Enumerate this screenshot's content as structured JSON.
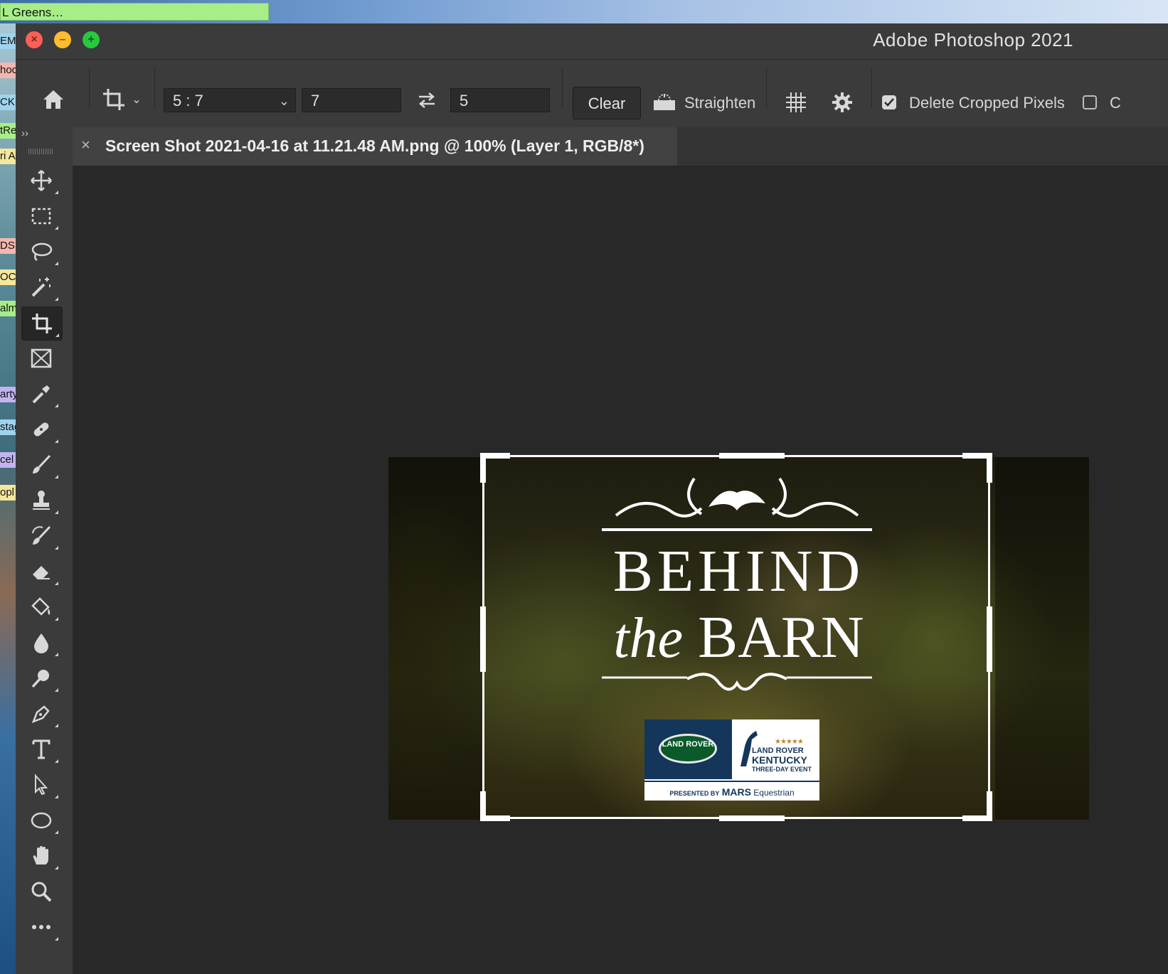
{
  "desktop": {
    "top_tab": "L Greens…",
    "side_labels": [
      "EM",
      "hoc",
      "CK",
      "tRe",
      "ri A",
      "DS",
      "OCI",
      "alm",
      "arty",
      "stag",
      "cel",
      "opl"
    ]
  },
  "window": {
    "title": "Adobe Photoshop 2021",
    "traffic_lights": [
      "close",
      "minimize",
      "maximize"
    ]
  },
  "options_bar": {
    "home_icon": "home-icon",
    "crop_preset_icon": "crop-icon",
    "ratio_preset": "5 : 7",
    "width_value": "7",
    "swap_icon": "swap-arrows-icon",
    "height_value": "5",
    "clear_label": "Clear",
    "straighten_label": "Straighten",
    "overlay_icon": "grid-icon",
    "settings_icon": "gear-icon",
    "delete_cropped_pixels_label": "Delete Cropped Pixels",
    "delete_cropped_pixels_checked": true,
    "content_aware_partial": "C"
  },
  "collapse_label": "››",
  "document": {
    "tab_title": "Screen Shot 2021-04-16 at 11.21.48 AM.png @ 100% (Layer 1, RGB/8*)",
    "tab_close": "×"
  },
  "toolbar": {
    "tools": [
      {
        "name": "move",
        "icon": "move-icon"
      },
      {
        "name": "rectangular-marquee",
        "icon": "marquee-icon"
      },
      {
        "name": "lasso",
        "icon": "lasso-icon"
      },
      {
        "name": "magic-wand",
        "icon": "magic-wand-icon"
      },
      {
        "name": "crop",
        "icon": "crop-icon",
        "active": true
      },
      {
        "name": "frame",
        "icon": "frame-icon"
      },
      {
        "name": "eyedropper",
        "icon": "eyedropper-icon"
      },
      {
        "name": "healing-brush",
        "icon": "bandage-icon"
      },
      {
        "name": "brush",
        "icon": "brush-icon"
      },
      {
        "name": "clone-stamp",
        "icon": "stamp-icon"
      },
      {
        "name": "history-brush",
        "icon": "history-brush-icon"
      },
      {
        "name": "eraser",
        "icon": "eraser-icon"
      },
      {
        "name": "paint-bucket",
        "icon": "paint-bucket-icon"
      },
      {
        "name": "blur",
        "icon": "drop-icon"
      },
      {
        "name": "dodge",
        "icon": "dodge-icon"
      },
      {
        "name": "pen",
        "icon": "pen-icon"
      },
      {
        "name": "type",
        "icon": "type-icon"
      },
      {
        "name": "path-selection",
        "icon": "arrow-icon"
      },
      {
        "name": "ellipse",
        "icon": "ellipse-icon"
      },
      {
        "name": "hand",
        "icon": "hand-icon"
      },
      {
        "name": "zoom",
        "icon": "zoom-icon"
      },
      {
        "name": "edit-toolbar",
        "icon": "more-icon"
      }
    ]
  },
  "canvas_image": {
    "line1": "BEHIND",
    "line2_italic": "the",
    "line2": "BARN",
    "logo_left": "LAND ROVER",
    "logo_right_l1": "LAND ROVER",
    "logo_right_l2": "KENTUCKY",
    "logo_right_l3": "THREE-DAY EVENT",
    "stars": "★★★★★",
    "presented_by": "PRESENTED BY",
    "sponsor": "MARS",
    "sponsor_suffix": "Equestrian"
  },
  "colors": {
    "panel_bg": "#3b3b3b",
    "canvas_bg": "#282828",
    "accent_green": "#a8ee88"
  }
}
